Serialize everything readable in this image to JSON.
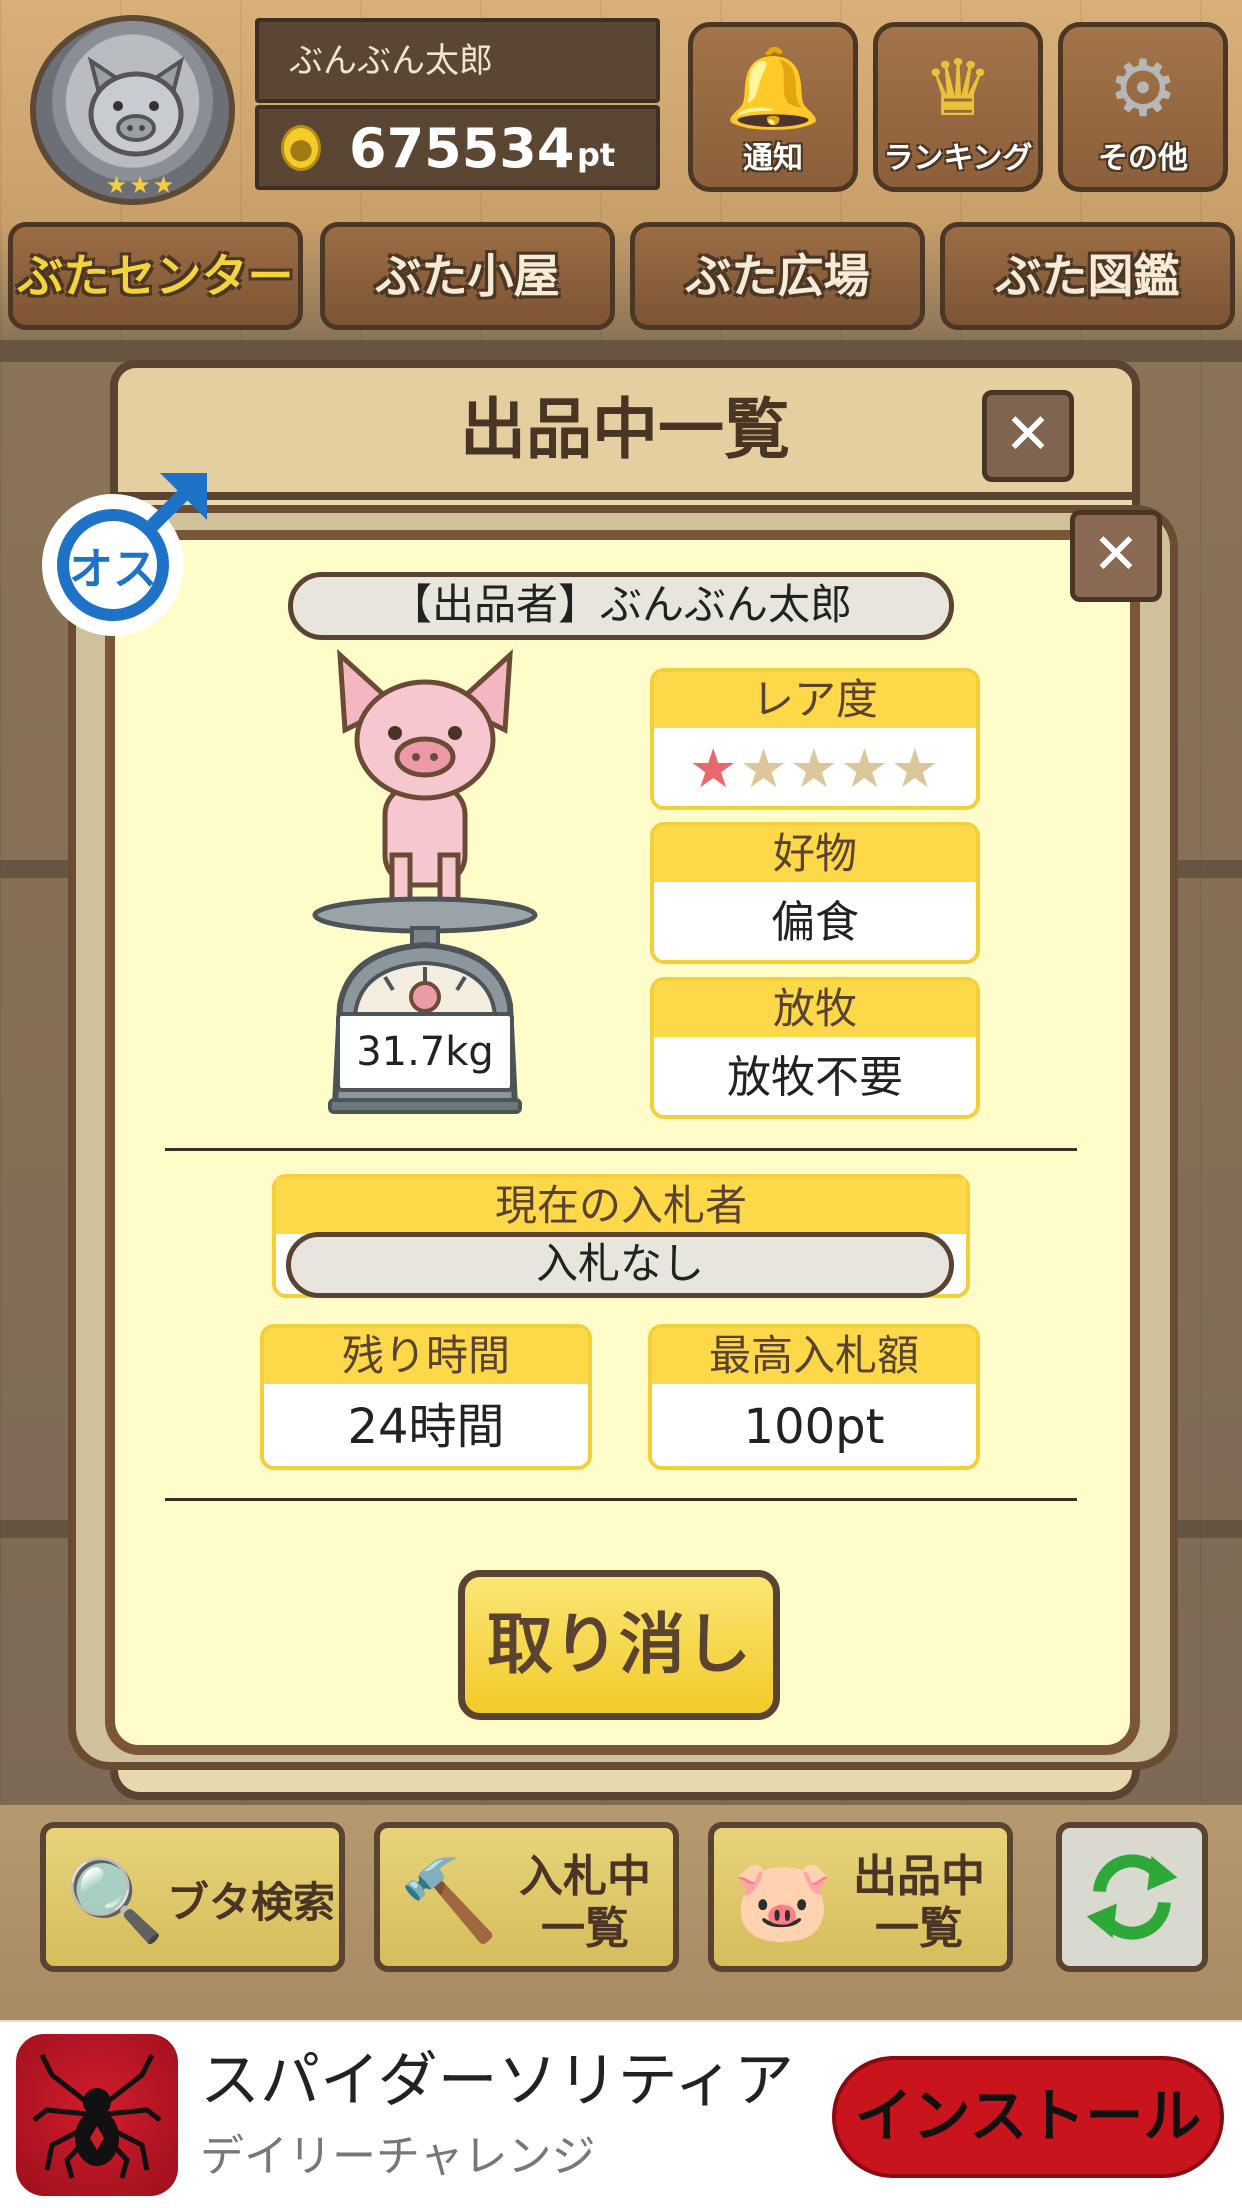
{
  "header": {
    "user_name": "ぶんぶん太郎",
    "points_value": "675534",
    "points_unit": "pt",
    "buttons": [
      {
        "label": "通知",
        "icon": "bell-icon"
      },
      {
        "label": "ランキング",
        "icon": "crown-icon"
      },
      {
        "label": "その他",
        "icon": "gear-icon"
      }
    ]
  },
  "tabs": [
    {
      "label": "ぶたセンター",
      "active": true
    },
    {
      "label": "ぶた小屋",
      "active": false
    },
    {
      "label": "ぶた広場",
      "active": false
    },
    {
      "label": "ぶた図鑑",
      "active": false
    }
  ],
  "list_panel": {
    "title": "出品中一覧",
    "close_glyph": "✕"
  },
  "modal": {
    "gender_label": "オス",
    "seller": "【出品者】ぶんぶん太郎",
    "weight": "31.7kg",
    "rarity": {
      "label": "レア度",
      "value": 1,
      "max": 5
    },
    "favorite": {
      "label": "好物",
      "value": "偏食"
    },
    "grazing": {
      "label": "放牧",
      "value": "放牧不要"
    },
    "current_bidder": {
      "label": "現在の入札者",
      "value": "入札なし"
    },
    "remaining_time": {
      "label": "残り時間",
      "value": "24時間"
    },
    "highest_bid": {
      "label": "最高入札額",
      "value": "100pt"
    },
    "cancel_label": "取り消し",
    "close_glyph": "✕"
  },
  "toolbar": {
    "search_label": "ブタ検索",
    "bidding_label": "入札中\n一覧",
    "listing_label": "出品中\n一覧"
  },
  "ad": {
    "title": "スパイダーソリティア",
    "subtitle": "デイリーチャレンジ",
    "install_label": "インストール"
  },
  "colors": {
    "modal_bg": "#fefcc9",
    "accent_yellow": "#fdd94a",
    "wood_dark": "#5a4330",
    "star_active": "#e8686e",
    "star_inactive": "#dcc79a",
    "install_red": "#c9141e"
  }
}
